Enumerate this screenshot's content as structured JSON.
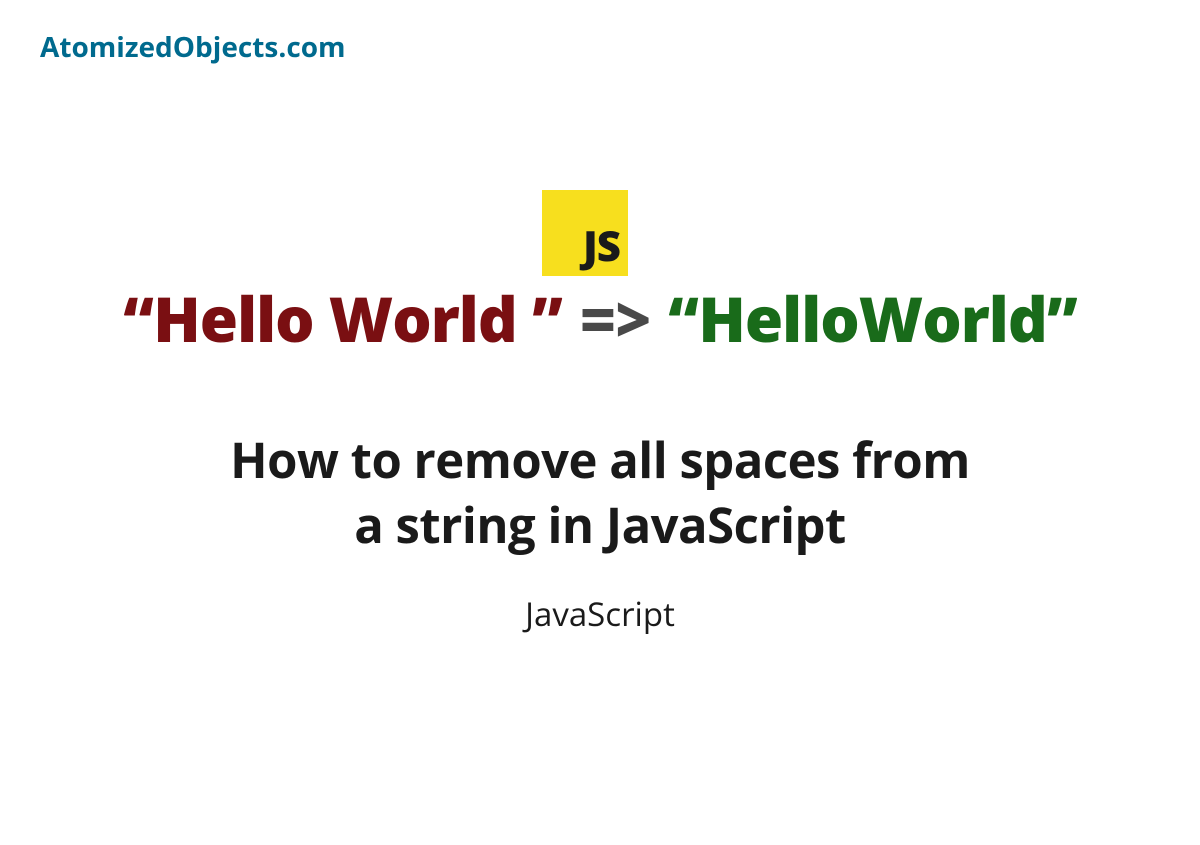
{
  "brand": "AtomizedObjects.com",
  "badge": {
    "label": "JS"
  },
  "example": {
    "input": "“Hello World ”",
    "arrow": "=>",
    "output": "“HelloWorld”"
  },
  "title": {
    "line1": "How to remove all spaces from",
    "line2": "a string in JavaScript"
  },
  "category": "JavaScript"
}
